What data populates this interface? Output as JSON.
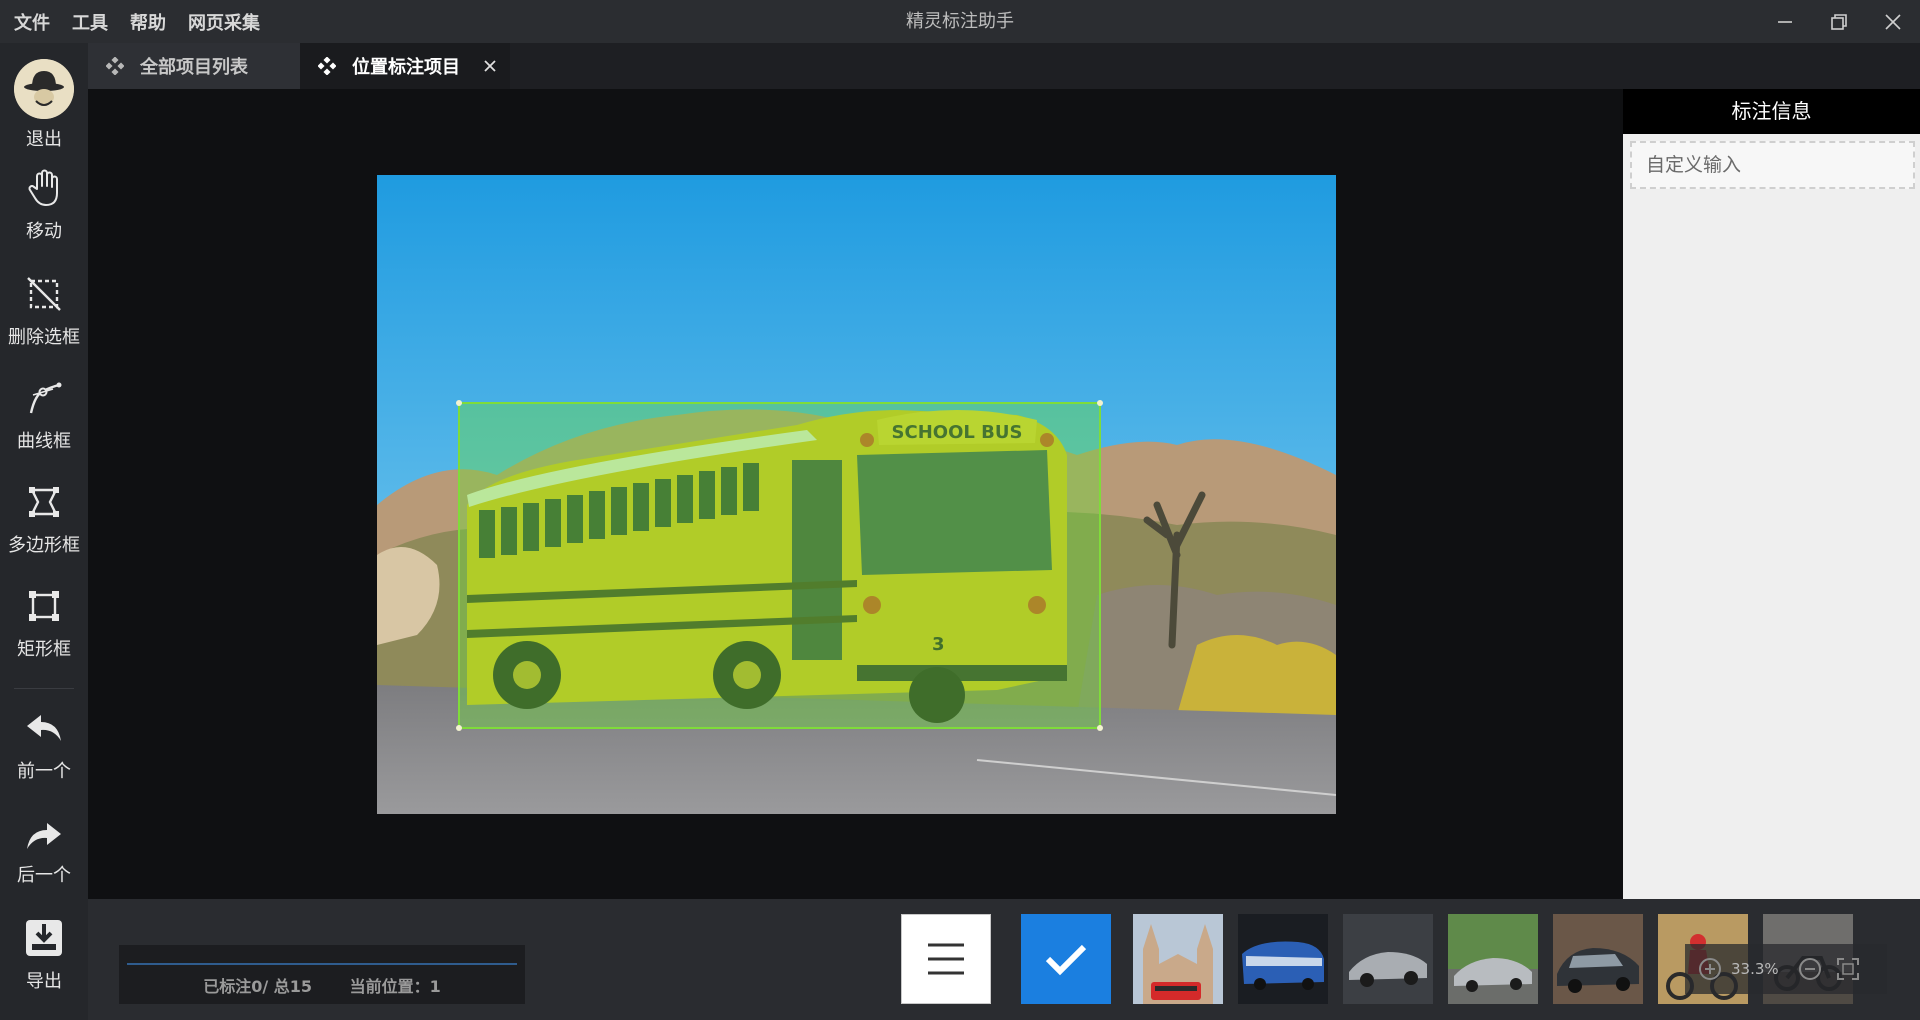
{
  "menu": [
    "文件",
    "工具",
    "帮助",
    "网页采集"
  ],
  "app_title": "精灵标注助手",
  "toolbar": {
    "logout": "退出",
    "move": "移动",
    "delete_box": "删除选框",
    "curve_box": "曲线框",
    "polygon_box": "多边形框",
    "rect_box": "矩形框",
    "prev": "前一个",
    "next": "后一个",
    "export": "导出"
  },
  "tabs": {
    "all_projects": "全部项目列表",
    "position_project": "位置标注项目"
  },
  "canvas": {
    "bus_sign": "SCHOOL BUS",
    "bus_number": "3"
  },
  "right_panel": {
    "title": "标注信息",
    "placeholder": "自定义输入"
  },
  "status": {
    "annotated": "已标注0/ 总15",
    "position": "当前位置：1",
    "progress": 0
  },
  "zoom": {
    "value": "33.3%"
  },
  "colors": {
    "accent": "#1b7fe0",
    "bbox": "#7fdc3a"
  }
}
